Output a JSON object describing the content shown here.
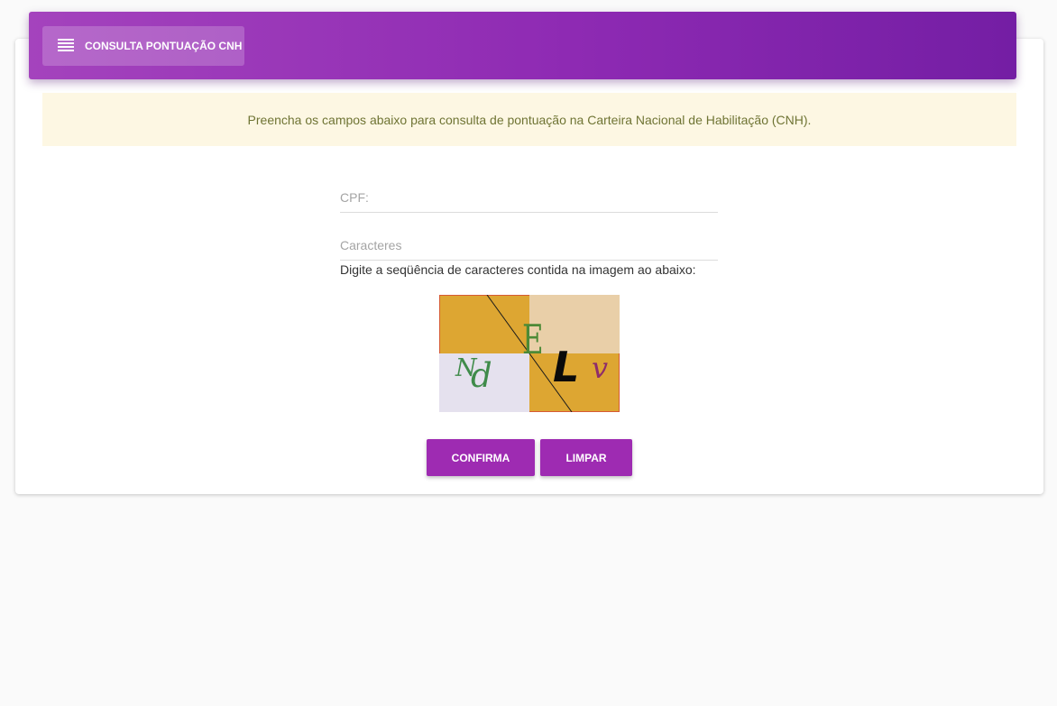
{
  "header": {
    "title": "CONSULTA PONTUAÇÃO CNH",
    "menu_icon": "hamburger-menu-icon",
    "gradient_start": "#a443bd",
    "gradient_end": "#741ea4"
  },
  "notice": {
    "text": "Preencha os campos abaixo para consulta de pontuação na Carteira Nacional de Habilitação (CNH).",
    "background": "#fdf7e3",
    "color": "#6f7434"
  },
  "form": {
    "cpf": {
      "placeholder": "CPF:",
      "value": ""
    },
    "characters": {
      "placeholder": "Caracteres",
      "value": ""
    },
    "hint": "Digite a seqüência de caracteres contida na imagem ao abaixo:"
  },
  "captcha": {
    "glyphs": [
      "N",
      "d",
      "E",
      "L",
      "v"
    ]
  },
  "buttons": {
    "confirm_label": "CONFIRMA",
    "clear_label": "LIMPAR",
    "color": "#9e2bb2"
  }
}
